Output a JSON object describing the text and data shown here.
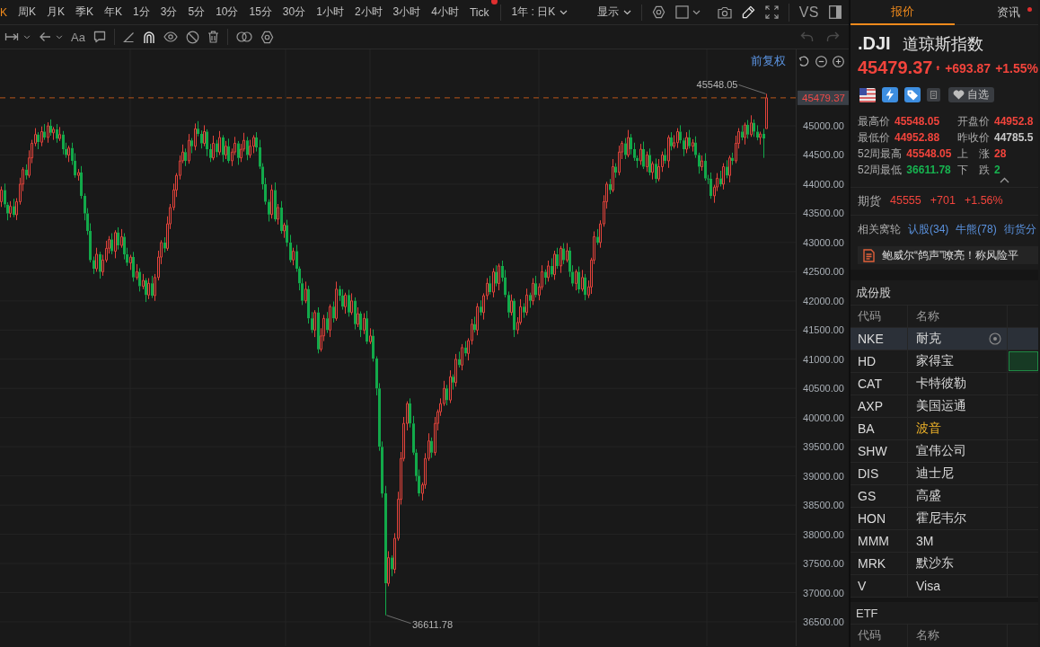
{
  "period_bar": {
    "periods": [
      {
        "label": "K",
        "selected": true,
        "badge": false
      },
      {
        "label": "周K",
        "selected": false,
        "badge": false
      },
      {
        "label": "月K",
        "selected": false,
        "badge": false
      },
      {
        "label": "季K",
        "selected": false,
        "badge": false
      },
      {
        "label": "年K",
        "selected": false,
        "badge": false
      },
      {
        "label": "1分",
        "selected": false,
        "badge": false
      },
      {
        "label": "3分",
        "selected": false,
        "badge": false
      },
      {
        "label": "5分",
        "selected": false,
        "badge": false
      },
      {
        "label": "10分",
        "selected": false,
        "badge": false
      },
      {
        "label": "15分",
        "selected": false,
        "badge": false
      },
      {
        "label": "30分",
        "selected": false,
        "badge": false
      },
      {
        "label": "1小时",
        "selected": false,
        "badge": false
      },
      {
        "label": "2小时",
        "selected": false,
        "badge": false
      },
      {
        "label": "3小时",
        "selected": false,
        "badge": false
      },
      {
        "label": "4小时",
        "selected": false,
        "badge": false
      },
      {
        "label": "Tick",
        "selected": false,
        "badge": true
      }
    ],
    "range": "1年 : 日K",
    "display": "显示",
    "compare": "VS"
  },
  "drawing_toolbar": {
    "text_tool": "Aa",
    "magnet_on": true,
    "undo_disabled": true,
    "redo_disabled": true
  },
  "chart": {
    "adjustment": "前复权",
    "high_label": "45548.05",
    "low_label": "36611.78",
    "chart_data": {
      "type": "candlestick",
      "grid": true,
      "ylim": [
        36084,
        46309
      ],
      "yticks": [
        {
          "value": 45000,
          "label": "45000.00"
        },
        {
          "value": 44500,
          "label": "44500.00"
        },
        {
          "value": 44000,
          "label": "44000.00"
        },
        {
          "value": 43500,
          "label": "43500.00"
        },
        {
          "value": 43000,
          "label": "43000.00"
        },
        {
          "value": 42500,
          "label": "42500.00"
        },
        {
          "value": 42000,
          "label": "42000.00"
        },
        {
          "value": 41500,
          "label": "41500.00"
        },
        {
          "value": 41000,
          "label": "41000.00"
        },
        {
          "value": 40500,
          "label": "40500.00"
        },
        {
          "value": 40000,
          "label": "40000.00"
        },
        {
          "value": 39500,
          "label": "39500.00"
        },
        {
          "value": 39000,
          "label": "39000.00"
        },
        {
          "value": 38500,
          "label": "38500.00"
        },
        {
          "value": 38000,
          "label": "38000.00"
        },
        {
          "value": 37500,
          "label": "37500.00"
        },
        {
          "value": 37000,
          "label": "37000.00"
        },
        {
          "value": 36500,
          "label": "36500.00"
        }
      ],
      "ref_lines": [
        {
          "axis": "y",
          "value": 45479.37,
          "label": "45479.37"
        }
      ],
      "categories": [
        null,
        null,
        null,
        null,
        null,
        null,
        null,
        null,
        null,
        null,
        null,
        null,
        null,
        null,
        null,
        null,
        null,
        null,
        null,
        null,
        null,
        null,
        null,
        null,
        null,
        null,
        null,
        null,
        null,
        null,
        null,
        null,
        null,
        null,
        null,
        null,
        null,
        null,
        null,
        null,
        null,
        null,
        null,
        null,
        null,
        null,
        null,
        null,
        null,
        null,
        null,
        null,
        null,
        null,
        null,
        null,
        null,
        null,
        null,
        null,
        null,
        null,
        null,
        null,
        null,
        null,
        null,
        null,
        null,
        null,
        null,
        null,
        null,
        null,
        null,
        null,
        null,
        null,
        null,
        null,
        null,
        null,
        null,
        null,
        null,
        null,
        null,
        null,
        null,
        null,
        null,
        null,
        null,
        null,
        null,
        null,
        null,
        null,
        null,
        null,
        null,
        null,
        null,
        null,
        null,
        null,
        null,
        null,
        null,
        null,
        null,
        null,
        null,
        null,
        null,
        null,
        null,
        null,
        null,
        null,
        null,
        null,
        null,
        null,
        null,
        null,
        null,
        null,
        null,
        null,
        null,
        null,
        null,
        null,
        null,
        null,
        null,
        null,
        null,
        null,
        null,
        null,
        null,
        null,
        null,
        null,
        null,
        null,
        null,
        null,
        null,
        null,
        null,
        null,
        null,
        null,
        null,
        null,
        null,
        null,
        null,
        null,
        null,
        null,
        null,
        null,
        null,
        null,
        null,
        null,
        null,
        null,
        null,
        null,
        null,
        null,
        null,
        null,
        null,
        null,
        null,
        null,
        null,
        null,
        null,
        null,
        null,
        null,
        null,
        null,
        null,
        null,
        null,
        null,
        null,
        null,
        null,
        null,
        null,
        null,
        null,
        null,
        null,
        null,
        null,
        null,
        null,
        null,
        null,
        null,
        null,
        null,
        null,
        null,
        null,
        null,
        null,
        null,
        null,
        null,
        null,
        null,
        null,
        null,
        null,
        null,
        null,
        null,
        null,
        null,
        null,
        null,
        null,
        null,
        null,
        null,
        null,
        null,
        null,
        null,
        null,
        null,
        null,
        null,
        null,
        null,
        null,
        null,
        null,
        null,
        null,
        null,
        null,
        null,
        null,
        null,
        null,
        null,
        null
      ],
      "ohlc": [
        [
          43700,
          43960,
          43610,
          43900
        ],
        [
          43900,
          44010,
          43600,
          43650
        ],
        [
          43650,
          43690,
          43380,
          43500
        ],
        [
          43500,
          43710,
          43430,
          43620
        ],
        [
          43620,
          43750,
          43435,
          43475
        ],
        [
          43475,
          43760,
          43385,
          43700
        ],
        [
          43700,
          44110,
          43650,
          44000
        ],
        [
          44000,
          44290,
          43880,
          44250
        ],
        [
          44250,
          44340,
          44080,
          44150
        ],
        [
          44150,
          44580,
          44110,
          44450
        ],
        [
          44450,
          44760,
          44360,
          44700
        ],
        [
          44700,
          44960,
          44650,
          44850
        ],
        [
          44850,
          44890,
          44600,
          44720
        ],
        [
          44720,
          44990,
          44650,
          44900
        ],
        [
          44900,
          45030,
          44760,
          44800
        ],
        [
          44800,
          45060,
          44710,
          45000
        ],
        [
          45000,
          45110,
          44830,
          44880
        ],
        [
          44880,
          44980,
          44760,
          44940
        ],
        [
          44940,
          45030,
          44710,
          44780
        ],
        [
          44780,
          44980,
          44740,
          44850
        ],
        [
          44850,
          44910,
          44510,
          44600
        ],
        [
          44600,
          44710,
          44450,
          44500
        ],
        [
          44500,
          44660,
          44380,
          44620
        ],
        [
          44620,
          44710,
          44330,
          44400
        ],
        [
          44400,
          44530,
          44110,
          44150
        ],
        [
          44150,
          44260,
          44060,
          44200
        ],
        [
          44200,
          44310,
          43750,
          43800
        ],
        [
          43800,
          43840,
          43380,
          43500
        ],
        [
          43500,
          43590,
          43130,
          43200
        ],
        [
          43200,
          43330,
          42660,
          42700
        ],
        [
          42700,
          42760,
          42460,
          42550
        ],
        [
          42550,
          42910,
          42500,
          42800
        ],
        [
          42800,
          42840,
          42380,
          42500
        ],
        [
          42500,
          42790,
          42430,
          42700
        ],
        [
          42700,
          43030,
          42660,
          42900
        ],
        [
          42900,
          43110,
          42810,
          43050
        ],
        [
          43050,
          43160,
          42800,
          42850
        ],
        [
          42850,
          43210,
          42730,
          43170
        ],
        [
          43170,
          43260,
          42880,
          42950
        ],
        [
          42950,
          43230,
          42910,
          43100
        ],
        [
          43100,
          43160,
          42710,
          42800
        ],
        [
          42800,
          42910,
          42600,
          42650
        ],
        [
          42650,
          42790,
          42530,
          42750
        ],
        [
          42750,
          42840,
          42330,
          42400
        ],
        [
          42400,
          42630,
          42360,
          42500
        ],
        [
          42500,
          42560,
          42160,
          42250
        ],
        [
          42250,
          42460,
          42200,
          42350
        ],
        [
          42350,
          42390,
          41980,
          42100
        ],
        [
          42100,
          42390,
          42030,
          42300
        ],
        [
          42300,
          42430,
          42050,
          42090
        ],
        [
          42090,
          42460,
          42000,
          42400
        ],
        [
          42400,
          42860,
          42350,
          42750
        ],
        [
          42750,
          43040,
          42630,
          43000
        ],
        [
          43000,
          43090,
          42830,
          42900
        ],
        [
          42900,
          43450,
          42860,
          43320
        ],
        [
          43320,
          43660,
          43230,
          43600
        ],
        [
          43600,
          44010,
          43550,
          43900
        ],
        [
          43900,
          44190,
          43780,
          44150
        ],
        [
          44150,
          44490,
          44080,
          44400
        ],
        [
          44400,
          44680,
          44360,
          44550
        ],
        [
          44550,
          44610,
          44310,
          44400
        ],
        [
          44400,
          44860,
          44350,
          44750
        ],
        [
          44750,
          44790,
          44530,
          44650
        ],
        [
          44650,
          45040,
          44580,
          44950
        ],
        [
          44950,
          45080,
          44820,
          44860
        ],
        [
          44860,
          44920,
          44610,
          44700
        ],
        [
          44700,
          45010,
          44650,
          44900
        ],
        [
          44900,
          44940,
          44480,
          44600
        ],
        [
          44600,
          44690,
          44380,
          44450
        ],
        [
          44450,
          44830,
          44410,
          44700
        ],
        [
          44700,
          44760,
          44460,
          44550
        ],
        [
          44550,
          44910,
          44500,
          44800
        ],
        [
          44800,
          44840,
          44380,
          44500
        ],
        [
          44500,
          44740,
          44430,
          44650
        ],
        [
          44650,
          44780,
          44360,
          44400
        ],
        [
          44400,
          44610,
          44310,
          44550
        ],
        [
          44550,
          44810,
          44500,
          44700
        ],
        [
          44700,
          44740,
          44330,
          44450
        ],
        [
          44450,
          44690,
          44380,
          44600
        ],
        [
          44600,
          44880,
          44560,
          44750
        ],
        [
          44750,
          44810,
          44410,
          44500
        ],
        [
          44500,
          44760,
          44450,
          44650
        ],
        [
          44650,
          44840,
          44530,
          44800
        ],
        [
          44800,
          44890,
          44560,
          44630
        ],
        [
          44630,
          44760,
          44260,
          44300
        ],
        [
          44300,
          44360,
          43910,
          44000
        ],
        [
          44000,
          44110,
          43650,
          43700
        ],
        [
          43700,
          43740,
          43360,
          43480
        ],
        [
          43480,
          43990,
          43410,
          43900
        ],
        [
          43900,
          44030,
          43360,
          43400
        ],
        [
          43400,
          43660,
          43310,
          43600
        ],
        [
          43600,
          43710,
          43150,
          43200
        ],
        [
          43200,
          43340,
          43080,
          43300
        ],
        [
          43300,
          43390,
          42930,
          43000
        ],
        [
          43000,
          43130,
          42660,
          42700
        ],
        [
          42700,
          42910,
          42610,
          42850
        ],
        [
          42850,
          42960,
          42500,
          42550
        ],
        [
          42550,
          42590,
          42180,
          42300
        ],
        [
          42300,
          42390,
          41930,
          42000
        ],
        [
          42000,
          42330,
          41960,
          42200
        ],
        [
          42200,
          42260,
          41610,
          41700
        ],
        [
          41700,
          41810,
          41450,
          41500
        ],
        [
          41500,
          41840,
          41380,
          41800
        ],
        [
          41800,
          41890,
          41100,
          41170
        ],
        [
          41170,
          41530,
          41130,
          41400
        ],
        [
          41400,
          41760,
          41310,
          41700
        ],
        [
          41700,
          41810,
          41450,
          41500
        ],
        [
          41500,
          41940,
          41380,
          41900
        ],
        [
          41900,
          41990,
          41630,
          41700
        ],
        [
          41700,
          42330,
          41660,
          42200
        ],
        [
          42200,
          42260,
          42000,
          42090
        ],
        [
          42090,
          42200,
          41850,
          41900
        ],
        [
          41900,
          42140,
          41780,
          42100
        ],
        [
          42100,
          42190,
          41730,
          41800
        ],
        [
          41800,
          42130,
          41760,
          42000
        ],
        [
          42000,
          42060,
          41510,
          41600
        ],
        [
          41600,
          41890,
          41550,
          41780
        ],
        [
          41780,
          41820,
          41380,
          41500
        ],
        [
          41500,
          41790,
          41430,
          41700
        ],
        [
          41700,
          41830,
          41260,
          41300
        ],
        [
          41300,
          41530,
          41260,
          41400
        ],
        [
          41400,
          41510,
          40960,
          41010
        ],
        [
          41010,
          41050,
          40380,
          40500
        ],
        [
          40500,
          40590,
          39430,
          39500
        ],
        [
          39500,
          39590,
          38630,
          38700
        ],
        [
          38700,
          38830,
          36611.78,
          37160
        ],
        [
          37160,
          37710,
          37110,
          37600
        ],
        [
          37600,
          37640,
          37280,
          37400
        ],
        [
          37400,
          38020,
          37330,
          37930
        ],
        [
          37930,
          38730,
          37890,
          38600
        ],
        [
          38600,
          39410,
          38510,
          39300
        ],
        [
          39300,
          40010,
          39250,
          39900
        ],
        [
          39900,
          40280,
          39780,
          40240
        ],
        [
          40240,
          40330,
          39830,
          39900
        ],
        [
          39900,
          40030,
          39360,
          39400
        ],
        [
          39400,
          39460,
          38910,
          39000
        ],
        [
          39000,
          39110,
          38650,
          38700
        ],
        [
          38700,
          38890,
          38580,
          38850
        ],
        [
          38850,
          39390,
          38780,
          39300
        ],
        [
          39300,
          39730,
          39260,
          39600
        ],
        [
          39600,
          39660,
          39310,
          39400
        ],
        [
          39400,
          40010,
          39350,
          39900
        ],
        [
          39900,
          40140,
          39780,
          40100
        ],
        [
          40100,
          40330,
          40030,
          40240
        ],
        [
          40240,
          40630,
          40200,
          40500
        ],
        [
          40500,
          40560,
          40210,
          40300
        ],
        [
          40300,
          40810,
          40250,
          40700
        ],
        [
          40700,
          40740,
          40480,
          40600
        ],
        [
          40600,
          41090,
          40530,
          41000
        ],
        [
          41000,
          41130,
          40860,
          40900
        ],
        [
          40900,
          41260,
          40810,
          41200
        ],
        [
          41200,
          41310,
          41050,
          41100
        ],
        [
          41100,
          41360,
          40980,
          41320
        ],
        [
          41320,
          41690,
          41250,
          41600
        ],
        [
          41600,
          41730,
          41460,
          41500
        ],
        [
          41500,
          41960,
          41410,
          41900
        ],
        [
          41900,
          42010,
          41750,
          41800
        ],
        [
          41800,
          42130,
          41680,
          42090
        ],
        [
          42090,
          42390,
          42020,
          42300
        ],
        [
          42300,
          42430,
          42110,
          42150
        ],
        [
          42150,
          42560,
          42060,
          42500
        ],
        [
          42500,
          42610,
          42250,
          42300
        ],
        [
          42300,
          42640,
          42180,
          42600
        ],
        [
          42600,
          42690,
          42330,
          42400
        ],
        [
          42400,
          42530,
          42060,
          42100
        ],
        [
          42100,
          42160,
          41710,
          41800
        ],
        [
          41800,
          42110,
          41750,
          42000
        ],
        [
          42000,
          42040,
          41380,
          41500
        ],
        [
          41500,
          41720,
          41430,
          41630
        ],
        [
          41630,
          42030,
          41590,
          41900
        ],
        [
          41900,
          41960,
          41710,
          41800
        ],
        [
          41800,
          42210,
          41750,
          42100
        ],
        [
          42100,
          42140,
          41880,
          42000
        ],
        [
          42000,
          42390,
          41930,
          42300
        ],
        [
          42300,
          42430,
          42060,
          42100
        ],
        [
          42100,
          42300,
          42010,
          42240
        ],
        [
          42240,
          42610,
          42190,
          42500
        ],
        [
          42500,
          42540,
          42280,
          42400
        ],
        [
          42400,
          42690,
          42330,
          42600
        ],
        [
          42600,
          42730,
          42410,
          42450
        ],
        [
          42450,
          42860,
          42360,
          42800
        ],
        [
          42800,
          42910,
          42550,
          42600
        ],
        [
          42600,
          42940,
          42480,
          42900
        ],
        [
          42900,
          42990,
          42630,
          42700
        ],
        [
          42700,
          42990,
          42660,
          42860
        ],
        [
          42860,
          42920,
          42410,
          42500
        ],
        [
          42500,
          42610,
          42250,
          42300
        ],
        [
          42300,
          42540,
          42180,
          42500
        ],
        [
          42500,
          42590,
          42130,
          42200
        ],
        [
          42200,
          42530,
          42160,
          42400
        ],
        [
          42400,
          42460,
          42010,
          42100
        ],
        [
          42100,
          42350,
          42050,
          42240
        ],
        [
          42240,
          42740,
          42120,
          42700
        ],
        [
          42700,
          43190,
          42630,
          43100
        ],
        [
          43100,
          43230,
          42960,
          43000
        ],
        [
          43000,
          43380,
          42910,
          43320
        ],
        [
          43320,
          43810,
          43270,
          43700
        ],
        [
          43700,
          44040,
          43580,
          44000
        ],
        [
          44000,
          44090,
          43830,
          43900
        ],
        [
          43900,
          44430,
          43860,
          44300
        ],
        [
          44300,
          44360,
          44110,
          44200
        ],
        [
          44200,
          44660,
          44150,
          44550
        ],
        [
          44550,
          44740,
          44430,
          44700
        ],
        [
          44700,
          44790,
          44430,
          44500
        ],
        [
          44500,
          44930,
          44460,
          44800
        ],
        [
          44800,
          44860,
          44510,
          44600
        ],
        [
          44600,
          44710,
          44400,
          44450
        ],
        [
          44450,
          44490,
          44280,
          44400
        ],
        [
          44400,
          44690,
          44330,
          44600
        ],
        [
          44600,
          44730,
          44260,
          44300
        ],
        [
          44300,
          44560,
          44210,
          44500
        ],
        [
          44500,
          44610,
          44150,
          44200
        ],
        [
          44200,
          44390,
          44080,
          44350
        ],
        [
          44350,
          44440,
          44020,
          44090
        ],
        [
          44090,
          44430,
          44050,
          44300
        ],
        [
          44300,
          44560,
          44210,
          44500
        ],
        [
          44500,
          44610,
          44350,
          44400
        ],
        [
          44400,
          44840,
          44280,
          44800
        ],
        [
          44800,
          44890,
          44580,
          44650
        ],
        [
          44650,
          44840,
          44610,
          44710
        ],
        [
          44710,
          44960,
          44620,
          44900
        ],
        [
          44900,
          45010,
          44700,
          44750
        ],
        [
          44750,
          44790,
          44480,
          44600
        ],
        [
          44600,
          44890,
          44530,
          44800
        ],
        [
          44800,
          44930,
          44610,
          44650
        ],
        [
          44650,
          44770,
          44560,
          44710
        ],
        [
          44710,
          44820,
          44450,
          44500
        ],
        [
          44500,
          44540,
          44180,
          44300
        ],
        [
          44300,
          44490,
          44230,
          44400
        ],
        [
          44400,
          44530,
          44060,
          44100
        ],
        [
          44100,
          44160,
          44000,
          44090
        ],
        [
          44090,
          44200,
          43750,
          43800
        ],
        [
          43800,
          43990,
          43680,
          43950
        ],
        [
          43950,
          44190,
          43880,
          44100
        ],
        [
          44100,
          44230,
          43960,
          44000
        ],
        [
          44000,
          44360,
          43910,
          44300
        ],
        [
          44300,
          44410,
          44100,
          44150
        ],
        [
          44150,
          44490,
          44030,
          44450
        ],
        [
          44450,
          44540,
          44330,
          44400
        ],
        [
          44400,
          44830,
          44360,
          44700
        ],
        [
          44700,
          44960,
          44610,
          44900
        ],
        [
          44900,
          45010,
          44750,
          44800
        ],
        [
          44800,
          45055,
          44680,
          45015
        ],
        [
          45015,
          45100,
          44780,
          44850
        ],
        [
          44850,
          45180,
          44810,
          45050
        ],
        [
          45050,
          45110,
          44810,
          44900
        ],
        [
          44900,
          45010,
          44750,
          44800
        ],
        [
          44800,
          44900,
          44680,
          44860
        ],
        [
          44860,
          44950,
          44450,
          44785.5
        ],
        [
          44952.88,
          45548.05,
          44952.88,
          45479.37
        ],
        null,
        null,
        null,
        null,
        null,
        null,
        null,
        null,
        null
      ]
    }
  },
  "quote": {
    "tabs": [
      {
        "label": "报价",
        "selected": true,
        "dot": false
      },
      {
        "label": "资讯",
        "selected": false,
        "dot": true
      }
    ],
    "symbol": ".DJI",
    "name": "道琼斯指数",
    "price": "45479.37",
    "change": "+693.87",
    "change_pct": "+1.55%",
    "rising": true,
    "watchlist_button": "自选",
    "stats": [
      {
        "label": "最高价",
        "value": "45548.05",
        "color": "#f2443c"
      },
      {
        "label": "开盘价",
        "value": "44952.8",
        "color": "#f2443c"
      },
      {
        "label": "最低价",
        "value": "44952.88",
        "color": "#f2443c"
      },
      {
        "label": "昨收价",
        "value": "44785.5",
        "color": "#c9c9c9"
      },
      {
        "label": "52周最高",
        "value": "45548.05",
        "color": "#f2443c"
      },
      {
        "label": "上 涨",
        "value": "28",
        "color": "#f2443c"
      },
      {
        "label": "52周最低",
        "value": "36611.78",
        "color": "#17b350"
      },
      {
        "label": "下 跌",
        "value": "2",
        "color": "#17b350"
      }
    ],
    "futures": {
      "label": "期货",
      "price": "45555",
      "change": "+701",
      "change_pct": "+1.56%",
      "rising": true
    },
    "warrants": {
      "label": "相关窝轮",
      "links": [
        "认股(34)",
        "牛熊(78)",
        "街货分"
      ]
    },
    "news": "鲍威尔“鸽声”嘹亮！称风险平"
  },
  "constituents": {
    "title": "成份股",
    "columns": [
      "代码",
      "名称"
    ],
    "rows": [
      {
        "code": "NKE",
        "name": "耐克",
        "selected": true,
        "flash": false,
        "color": "#d9d9d9"
      },
      {
        "code": "HD",
        "name": "家得宝",
        "selected": false,
        "flash": true,
        "color": "#d9d9d9"
      },
      {
        "code": "CAT",
        "name": "卡特彼勒",
        "selected": false,
        "flash": false,
        "color": "#d9d9d9"
      },
      {
        "code": "AXP",
        "name": "美国运通",
        "selected": false,
        "flash": false,
        "color": "#d9d9d9"
      },
      {
        "code": "BA",
        "name": "波音",
        "selected": false,
        "flash": false,
        "color": "#f0b429"
      },
      {
        "code": "SHW",
        "name": "宣伟公司",
        "selected": false,
        "flash": false,
        "color": "#d9d9d9"
      },
      {
        "code": "DIS",
        "name": "迪士尼",
        "selected": false,
        "flash": false,
        "color": "#d9d9d9"
      },
      {
        "code": "GS",
        "name": "高盛",
        "selected": false,
        "flash": false,
        "color": "#d9d9d9"
      },
      {
        "code": "HON",
        "name": "霍尼韦尔",
        "selected": false,
        "flash": false,
        "color": "#d9d9d9"
      },
      {
        "code": "MMM",
        "name": "3M",
        "selected": false,
        "flash": false,
        "color": "#d9d9d9"
      },
      {
        "code": "MRK",
        "name": "默沙东",
        "selected": false,
        "flash": false,
        "color": "#d9d9d9"
      },
      {
        "code": "V",
        "name": "Visa",
        "selected": false,
        "flash": false,
        "color": "#d9d9d9"
      }
    ]
  },
  "etf": {
    "title": "ETF",
    "columns": [
      "代码",
      "名称"
    ]
  }
}
